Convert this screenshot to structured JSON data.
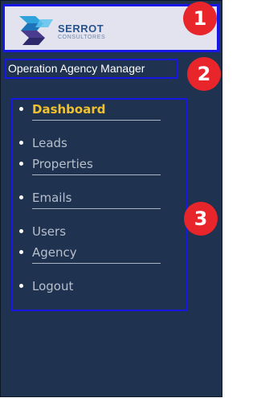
{
  "logo": {
    "name": "SERROT",
    "subtitle": "CONSULTORES"
  },
  "app_title": "Operation Agency Manager",
  "nav": {
    "items": [
      {
        "label": "Dashboard",
        "active": true
      },
      {
        "label": "Leads",
        "active": false
      },
      {
        "label": "Properties",
        "active": false
      },
      {
        "label": "Emails",
        "active": false
      },
      {
        "label": "Users",
        "active": false
      },
      {
        "label": "Agency",
        "active": false
      },
      {
        "label": "Logout",
        "active": false
      }
    ]
  },
  "annotations": [
    "1",
    "2",
    "3"
  ],
  "colors": {
    "sidebar_bg": "#1f3350",
    "active_item": "#f2c22e",
    "annotation_box": "#1616e6",
    "annotation_badge": "#e8252b"
  }
}
